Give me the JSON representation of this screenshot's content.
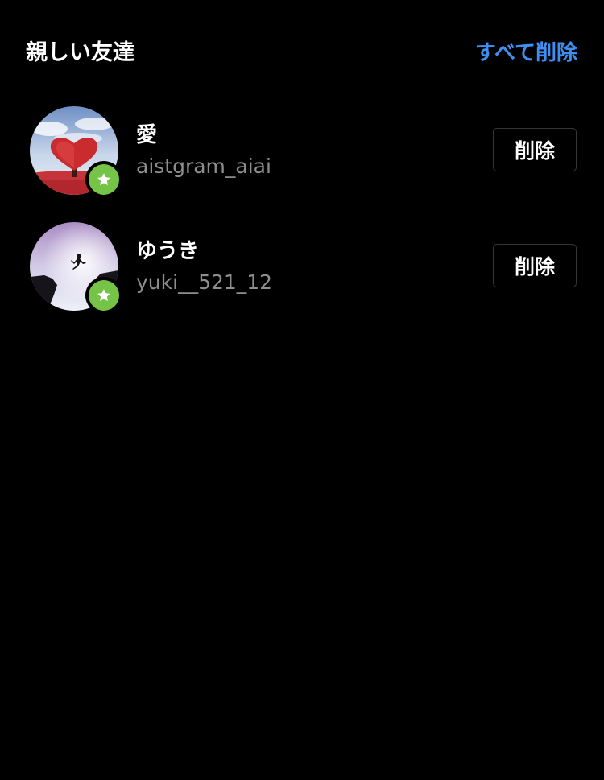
{
  "header": {
    "title": "親しい友達",
    "remove_all_label": "すべて削除"
  },
  "friends": [
    {
      "name": "愛",
      "username": "aistgram_aiai",
      "remove_label": "削除",
      "avatar_icon": "red-heart-tree-photo",
      "badge_icon": "star-icon"
    },
    {
      "name": "ゆうき",
      "username": "yuki__521_12",
      "remove_label": "削除",
      "avatar_icon": "cliff-jump-silhouette-photo",
      "badge_icon": "star-icon"
    }
  ],
  "colors": {
    "background": "#000000",
    "accent": "#3f8ff0",
    "secondary_text": "#8e8e8e",
    "close_friend_badge": "#75c448",
    "button_border": "#363636"
  }
}
